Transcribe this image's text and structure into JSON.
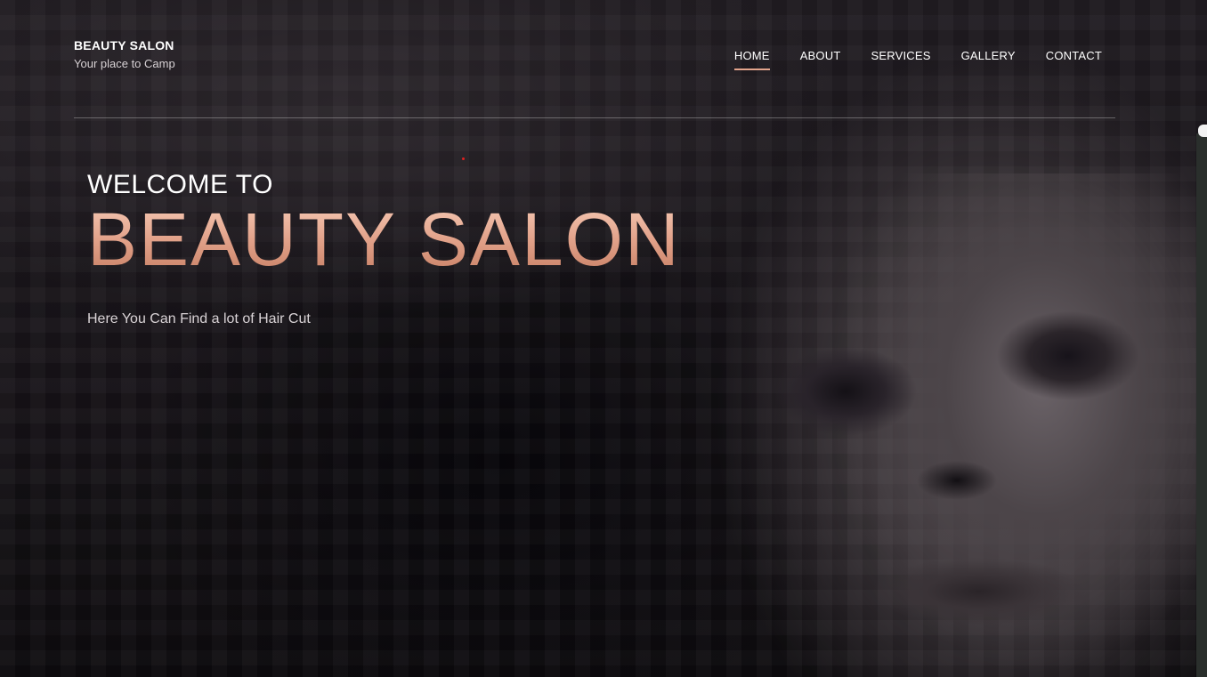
{
  "brand": {
    "name": "BEAUTY SALON",
    "tagline": "Your place to Camp"
  },
  "nav": {
    "items": [
      {
        "label": "HOME",
        "active": true
      },
      {
        "label": "ABOUT",
        "active": false
      },
      {
        "label": "SERVICES",
        "active": false
      },
      {
        "label": "GALLERY",
        "active": false
      },
      {
        "label": "CONTACT",
        "active": false
      }
    ]
  },
  "hero": {
    "welcome": "WELCOME TO",
    "title": "BEAUTY SALON",
    "subtitle": "Here You Can Find a lot of Hair Cut"
  },
  "colors": {
    "accent": "#e3a48c",
    "background": "#141115",
    "text": "#ffffff"
  }
}
